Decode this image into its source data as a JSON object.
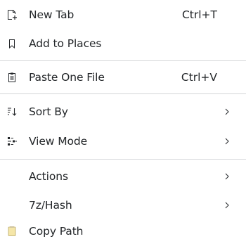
{
  "menu": {
    "items": [
      {
        "label": "New Tab",
        "shortcut": "Ctrl+T",
        "icon": "new-tab-icon",
        "submenu": false
      },
      {
        "label": "Add to Places",
        "shortcut": "",
        "icon": "bookmark-icon",
        "submenu": false
      },
      {
        "label": "Paste One File",
        "shortcut": "Ctrl+V",
        "icon": "paste-icon",
        "submenu": false
      },
      {
        "label": "Sort By",
        "shortcut": "",
        "icon": "sort-icon",
        "submenu": true
      },
      {
        "label": "View Mode",
        "shortcut": "",
        "icon": "view-mode-icon",
        "submenu": true
      },
      {
        "label": "Actions",
        "shortcut": "",
        "icon": "",
        "submenu": true
      },
      {
        "label": "7z/Hash",
        "shortcut": "",
        "icon": "",
        "submenu": true
      },
      {
        "label": "Copy Path",
        "shortcut": "",
        "icon": "copy-path-icon",
        "submenu": false
      }
    ]
  },
  "colors": {
    "background": "#ffffff",
    "text": "#232629",
    "separator": "#d3d5d8",
    "icon": "#232629",
    "copy_path_icon_fill": "#f5e6a8"
  }
}
